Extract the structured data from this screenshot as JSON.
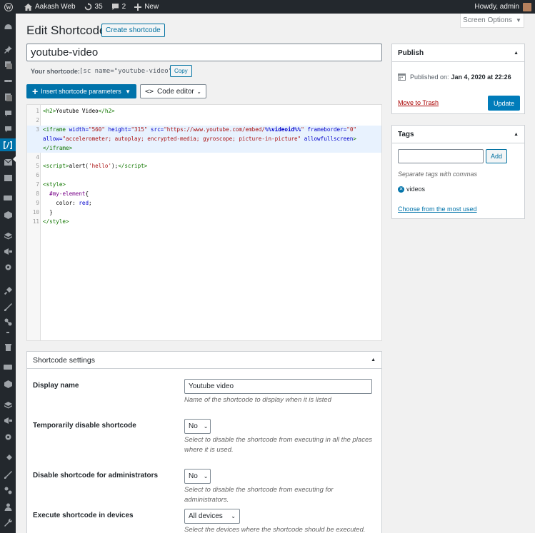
{
  "adminbar": {
    "site_name": "Aakash Web",
    "updates_count": "35",
    "comments_count": "2",
    "new_label": "New",
    "howdy": "Howdy, admin"
  },
  "screen_options": "Screen Options",
  "page": {
    "title": "Edit Shortcode",
    "create_button": "Create shortcode",
    "shortcode_title": "youtube-video",
    "your_shortcode_label": "Your shortcode:",
    "your_shortcode_value": "[sc name=\"youtube-video\"]",
    "copy_button": "Copy",
    "insert_params_button": "Insert shortcode parameters",
    "code_editor_button": "Code editor"
  },
  "editor": {
    "lines": [
      {
        "n": "1",
        "html": "<span class='tag'>&lt;h2&gt;</span><span class='plain'>Youtube Video</span><span class='tag'>&lt;/h2&gt;</span>"
      },
      {
        "n": "2",
        "html": ""
      },
      {
        "n": "3",
        "html": "<span class='tag'>&lt;iframe</span> <span class='attr'>width=</span><span class='str'>\"560\"</span> <span class='attr'>height=</span><span class='str'>\"315\"</span> <span class='attr'>src=</span><span class='str'>\"https://www.youtube.com/embed/</span><span class='bold'>%%videoid%%</span><span class='str'>\"</span> <span class='attr'>frameborder=</span><span class='str'>\"0\"</span>"
      },
      {
        "n": "",
        "html": "<span class='attr'>allow=</span><span class='str'>\"accelerometer; autoplay; encrypted-media; gyroscope; picture-in-picture\"</span> <span class='attr'>allowfullscreen</span><span class='tag'>&gt;</span>"
      },
      {
        "n": "",
        "html": "<span class='tag'>&lt;/iframe&gt;</span>"
      },
      {
        "n": "4",
        "html": ""
      },
      {
        "n": "5",
        "html": "<span class='tag'>&lt;script&gt;</span><span class='plain'>alert(</span><span class='str'>'hello'</span><span class='plain'>);</span><span class='tag'>&lt;/script&gt;</span>"
      },
      {
        "n": "6",
        "html": ""
      },
      {
        "n": "7",
        "html": "<span class='tag'>&lt;style&gt;</span>"
      },
      {
        "n": "8",
        "html": "  <span class='kw'>#my-element</span><span class='plain'>{</span>"
      },
      {
        "n": "9",
        "html": "    <span class='plain'>color: </span><span class='attr'>red</span><span class='plain'>;</span>"
      },
      {
        "n": "10",
        "html": "  <span class='plain'>}</span>"
      },
      {
        "n": "11",
        "html": "<span class='tag'>&lt;/style&gt;</span>"
      }
    ]
  },
  "publish": {
    "heading": "Publish",
    "published_on_label": "Published on:",
    "published_on_value": "Jan 4, 2020 at 22:26",
    "trash_link": "Move to Trash",
    "update_button": "Update"
  },
  "tags": {
    "heading": "Tags",
    "input_value": "",
    "add_button": "Add",
    "hint": "Separate tags with commas",
    "items": [
      "videos"
    ],
    "choose_link": "Choose from the most used"
  },
  "settings": {
    "heading": "Shortcode settings",
    "display_name_label": "Display name",
    "display_name_value": "Youtube video",
    "display_name_desc": "Name of the shortcode to display when it is listed",
    "temp_disable_label": "Temporarily disable shortcode",
    "temp_disable_value": "No",
    "temp_disable_desc": "Select to disable the shortcode from executing in all the places where it is used.",
    "admin_disable_label": "Disable shortcode for administrators",
    "admin_disable_value": "No",
    "admin_disable_desc": "Select to disable the shortcode from executing for administrators.",
    "devices_label": "Execute shortcode in devices",
    "devices_value": "All devices",
    "devices_desc": "Select the devices where the shortcode should be executed. Note:"
  },
  "colors": {
    "admin_bar": "#23282d",
    "accent": "#0073aa",
    "background": "#f1f1f1"
  },
  "icons": [
    "wordpress-icon",
    "home-icon",
    "refresh-icon",
    "comment-icon",
    "plus-icon",
    "dashboard-icon",
    "pin-icon",
    "media-icon",
    "link-icon",
    "page-icon",
    "comments-icon",
    "shortcode-icon",
    "mail-icon",
    "woo-icon",
    "box-icon",
    "calendar-icon"
  ]
}
